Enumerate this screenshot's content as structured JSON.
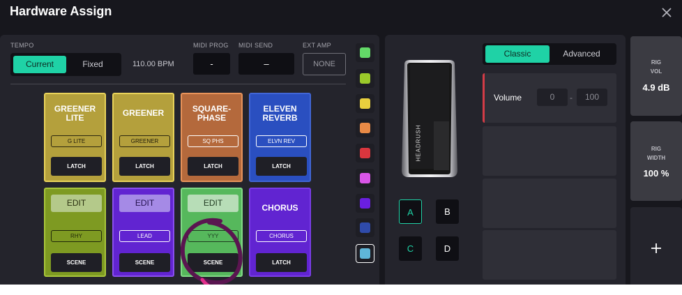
{
  "header": {
    "title": "Hardware Assign",
    "close_icon": "close-icon"
  },
  "tempo": {
    "label": "TEMPO",
    "options": [
      "Current",
      "Fixed"
    ],
    "selected": "Current",
    "bpm": "110.00 BPM"
  },
  "midi_prog": {
    "label": "MIDI PROG",
    "value": "-"
  },
  "midi_send": {
    "label": "MIDI SEND",
    "value": "–"
  },
  "ext_amp": {
    "label": "EXT AMP",
    "value": "NONE"
  },
  "footswitches": [
    {
      "name_lines": [
        "GREENER",
        "LITE"
      ],
      "label": "G LITE",
      "button": "LATCH"
    },
    {
      "name_lines": [
        "GREENER"
      ],
      "label": "GREENER",
      "button": "LATCH"
    },
    {
      "name_lines": [
        "SQUARE-",
        "PHASE"
      ],
      "label": "SQ PHS",
      "button": "LATCH"
    },
    {
      "name_lines": [
        "ELEVEN",
        "REVERB"
      ],
      "label": "ELVN REV",
      "button": "LATCH"
    },
    {
      "edit": "EDIT",
      "label": "RHY",
      "button": "SCENE"
    },
    {
      "edit": "EDIT",
      "label": "LEAD",
      "button": "SCENE"
    },
    {
      "edit": "EDIT",
      "label": "YYY",
      "button": "SCENE"
    },
    {
      "name_lines": [
        "CHORUS"
      ],
      "label": "CHORUS",
      "button": "LATCH"
    }
  ],
  "colors": {
    "swatches": [
      "#63d968",
      "#9bc92a",
      "#e8cf3e",
      "#e98a46",
      "#d9363e",
      "#d955e8",
      "#6a1fe0",
      "#2f4bab",
      "#5fb6d9"
    ],
    "selected_index": 8,
    "accent": "#1fd2a6"
  },
  "pedal": {
    "brand": "HEADRUSH",
    "buttons": [
      "A",
      "B",
      "C",
      "D"
    ],
    "selected": "A"
  },
  "mode": {
    "options": [
      "Classic",
      "Advanced"
    ],
    "selected": "Classic"
  },
  "assignment": {
    "name": "Volume",
    "min": "0",
    "dash": "-",
    "max": "100"
  },
  "rig_vol": {
    "label_lines": [
      "RIG",
      "VOL"
    ],
    "value": "4.9 dB"
  },
  "rig_width": {
    "label_lines": [
      "RIG",
      "WIDTH"
    ],
    "value": "100 %"
  },
  "add": {
    "icon": "plus-icon"
  }
}
